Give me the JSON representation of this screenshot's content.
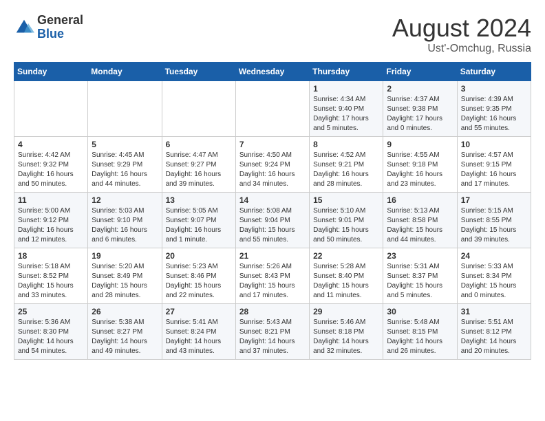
{
  "header": {
    "logo": {
      "general": "General",
      "blue": "Blue"
    },
    "title": "August 2024",
    "subtitle": "Ust'-Omchug, Russia"
  },
  "weekdays": [
    "Sunday",
    "Monday",
    "Tuesday",
    "Wednesday",
    "Thursday",
    "Friday",
    "Saturday"
  ],
  "weeks": [
    [
      {
        "day": "",
        "sunrise": "",
        "sunset": "",
        "daylight": ""
      },
      {
        "day": "",
        "sunrise": "",
        "sunset": "",
        "daylight": ""
      },
      {
        "day": "",
        "sunrise": "",
        "sunset": "",
        "daylight": ""
      },
      {
        "day": "",
        "sunrise": "",
        "sunset": "",
        "daylight": ""
      },
      {
        "day": "1",
        "sunrise": "Sunrise: 4:34 AM",
        "sunset": "Sunset: 9:40 PM",
        "daylight": "Daylight: 17 hours and 5 minutes."
      },
      {
        "day": "2",
        "sunrise": "Sunrise: 4:37 AM",
        "sunset": "Sunset: 9:38 PM",
        "daylight": "Daylight: 17 hours and 0 minutes."
      },
      {
        "day": "3",
        "sunrise": "Sunrise: 4:39 AM",
        "sunset": "Sunset: 9:35 PM",
        "daylight": "Daylight: 16 hours and 55 minutes."
      }
    ],
    [
      {
        "day": "4",
        "sunrise": "Sunrise: 4:42 AM",
        "sunset": "Sunset: 9:32 PM",
        "daylight": "Daylight: 16 hours and 50 minutes."
      },
      {
        "day": "5",
        "sunrise": "Sunrise: 4:45 AM",
        "sunset": "Sunset: 9:29 PM",
        "daylight": "Daylight: 16 hours and 44 minutes."
      },
      {
        "day": "6",
        "sunrise": "Sunrise: 4:47 AM",
        "sunset": "Sunset: 9:27 PM",
        "daylight": "Daylight: 16 hours and 39 minutes."
      },
      {
        "day": "7",
        "sunrise": "Sunrise: 4:50 AM",
        "sunset": "Sunset: 9:24 PM",
        "daylight": "Daylight: 16 hours and 34 minutes."
      },
      {
        "day": "8",
        "sunrise": "Sunrise: 4:52 AM",
        "sunset": "Sunset: 9:21 PM",
        "daylight": "Daylight: 16 hours and 28 minutes."
      },
      {
        "day": "9",
        "sunrise": "Sunrise: 4:55 AM",
        "sunset": "Sunset: 9:18 PM",
        "daylight": "Daylight: 16 hours and 23 minutes."
      },
      {
        "day": "10",
        "sunrise": "Sunrise: 4:57 AM",
        "sunset": "Sunset: 9:15 PM",
        "daylight": "Daylight: 16 hours and 17 minutes."
      }
    ],
    [
      {
        "day": "11",
        "sunrise": "Sunrise: 5:00 AM",
        "sunset": "Sunset: 9:12 PM",
        "daylight": "Daylight: 16 hours and 12 minutes."
      },
      {
        "day": "12",
        "sunrise": "Sunrise: 5:03 AM",
        "sunset": "Sunset: 9:10 PM",
        "daylight": "Daylight: 16 hours and 6 minutes."
      },
      {
        "day": "13",
        "sunrise": "Sunrise: 5:05 AM",
        "sunset": "Sunset: 9:07 PM",
        "daylight": "Daylight: 16 hours and 1 minute."
      },
      {
        "day": "14",
        "sunrise": "Sunrise: 5:08 AM",
        "sunset": "Sunset: 9:04 PM",
        "daylight": "Daylight: 15 hours and 55 minutes."
      },
      {
        "day": "15",
        "sunrise": "Sunrise: 5:10 AM",
        "sunset": "Sunset: 9:01 PM",
        "daylight": "Daylight: 15 hours and 50 minutes."
      },
      {
        "day": "16",
        "sunrise": "Sunrise: 5:13 AM",
        "sunset": "Sunset: 8:58 PM",
        "daylight": "Daylight: 15 hours and 44 minutes."
      },
      {
        "day": "17",
        "sunrise": "Sunrise: 5:15 AM",
        "sunset": "Sunset: 8:55 PM",
        "daylight": "Daylight: 15 hours and 39 minutes."
      }
    ],
    [
      {
        "day": "18",
        "sunrise": "Sunrise: 5:18 AM",
        "sunset": "Sunset: 8:52 PM",
        "daylight": "Daylight: 15 hours and 33 minutes."
      },
      {
        "day": "19",
        "sunrise": "Sunrise: 5:20 AM",
        "sunset": "Sunset: 8:49 PM",
        "daylight": "Daylight: 15 hours and 28 minutes."
      },
      {
        "day": "20",
        "sunrise": "Sunrise: 5:23 AM",
        "sunset": "Sunset: 8:46 PM",
        "daylight": "Daylight: 15 hours and 22 minutes."
      },
      {
        "day": "21",
        "sunrise": "Sunrise: 5:26 AM",
        "sunset": "Sunset: 8:43 PM",
        "daylight": "Daylight: 15 hours and 17 minutes."
      },
      {
        "day": "22",
        "sunrise": "Sunrise: 5:28 AM",
        "sunset": "Sunset: 8:40 PM",
        "daylight": "Daylight: 15 hours and 11 minutes."
      },
      {
        "day": "23",
        "sunrise": "Sunrise: 5:31 AM",
        "sunset": "Sunset: 8:37 PM",
        "daylight": "Daylight: 15 hours and 5 minutes."
      },
      {
        "day": "24",
        "sunrise": "Sunrise: 5:33 AM",
        "sunset": "Sunset: 8:34 PM",
        "daylight": "Daylight: 15 hours and 0 minutes."
      }
    ],
    [
      {
        "day": "25",
        "sunrise": "Sunrise: 5:36 AM",
        "sunset": "Sunset: 8:30 PM",
        "daylight": "Daylight: 14 hours and 54 minutes."
      },
      {
        "day": "26",
        "sunrise": "Sunrise: 5:38 AM",
        "sunset": "Sunset: 8:27 PM",
        "daylight": "Daylight: 14 hours and 49 minutes."
      },
      {
        "day": "27",
        "sunrise": "Sunrise: 5:41 AM",
        "sunset": "Sunset: 8:24 PM",
        "daylight": "Daylight: 14 hours and 43 minutes."
      },
      {
        "day": "28",
        "sunrise": "Sunrise: 5:43 AM",
        "sunset": "Sunset: 8:21 PM",
        "daylight": "Daylight: 14 hours and 37 minutes."
      },
      {
        "day": "29",
        "sunrise": "Sunrise: 5:46 AM",
        "sunset": "Sunset: 8:18 PM",
        "daylight": "Daylight: 14 hours and 32 minutes."
      },
      {
        "day": "30",
        "sunrise": "Sunrise: 5:48 AM",
        "sunset": "Sunset: 8:15 PM",
        "daylight": "Daylight: 14 hours and 26 minutes."
      },
      {
        "day": "31",
        "sunrise": "Sunrise: 5:51 AM",
        "sunset": "Sunset: 8:12 PM",
        "daylight": "Daylight: 14 hours and 20 minutes."
      }
    ]
  ]
}
